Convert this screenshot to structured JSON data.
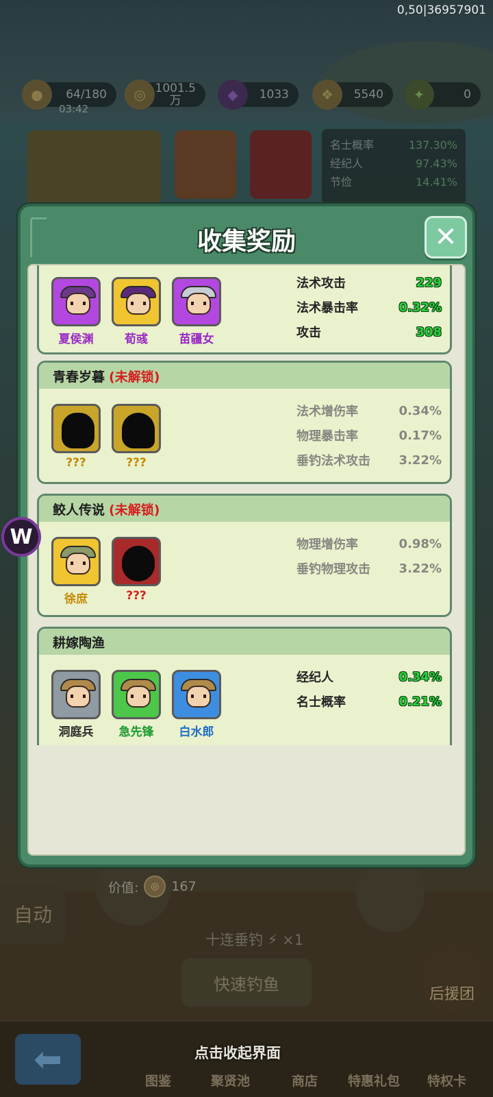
{
  "top_id": "0,50|36957901",
  "resources": [
    {
      "icon": "food-icon",
      "value": "64/180",
      "sub": "03:42"
    },
    {
      "icon": "coin-icon",
      "value": "1001.5\n万"
    },
    {
      "icon": "gem-icon",
      "value": "1033"
    },
    {
      "icon": "fish-icon",
      "value": "5540"
    },
    {
      "icon": "energy-icon",
      "value": "0"
    }
  ],
  "bg_stats": [
    {
      "label": "名士概率",
      "value": "137.30%"
    },
    {
      "label": "经纪人",
      "value": "97.43%"
    },
    {
      "label": "节俭",
      "value": "14.41%"
    }
  ],
  "dialog": {
    "title": "收集奖励",
    "close_label": "✕"
  },
  "cards": [
    {
      "title": "",
      "locked": false,
      "heroes": [
        {
          "name": "夏侯渊",
          "rarity": "purple",
          "name_color": "#9b2bc4"
        },
        {
          "name": "荀彧",
          "rarity": "gold",
          "name_color": "#9b2bc4"
        },
        {
          "name": "苗疆女",
          "rarity": "purple",
          "name_color": "#9b2bc4"
        }
      ],
      "bonuses": [
        {
          "label": "法术攻击",
          "value": "229"
        },
        {
          "label": "法术暴击率",
          "value": "0.32%"
        },
        {
          "label": "攻击",
          "value": "308"
        }
      ]
    },
    {
      "title": "青春岁暮",
      "locked": true,
      "locked_label": "(未解锁)",
      "heroes": [
        {
          "name": "???",
          "rarity": "gold-locked",
          "name_color": "#c48a00"
        },
        {
          "name": "???",
          "rarity": "gold-locked",
          "name_color": "#c48a00"
        }
      ],
      "bonuses": [
        {
          "label": "法术增伤率",
          "value": "0.34%"
        },
        {
          "label": "物理暴击率",
          "value": "0.17%"
        },
        {
          "label": "垂钓法术攻击",
          "value": "3.22%"
        }
      ]
    },
    {
      "title": "鲛人传说",
      "locked": true,
      "locked_label": "(未解锁)",
      "heroes": [
        {
          "name": "徐庶",
          "rarity": "gold",
          "name_color": "#c48a00"
        },
        {
          "name": "???",
          "rarity": "red-locked",
          "name_color": "#d51f1f"
        }
      ],
      "bonuses": [
        {
          "label": "物理增伤率",
          "value": "0.98%"
        },
        {
          "label": "垂钓物理攻击",
          "value": "3.22%"
        }
      ]
    },
    {
      "title": "耕嫁陶渔",
      "locked": false,
      "heroes": [
        {
          "name": "洞庭兵",
          "rarity": "gray",
          "name_color": "#2a2a2a"
        },
        {
          "name": "急先锋",
          "rarity": "green",
          "name_color": "#1d9a2e"
        },
        {
          "name": "白水郎",
          "rarity": "blue",
          "name_color": "#1e6fc4"
        }
      ],
      "bonuses": [
        {
          "label": "经纪人",
          "value": "0.34%"
        },
        {
          "label": "名士概率",
          "value": "0.21%"
        }
      ]
    }
  ],
  "background": {
    "auto_label": "自动",
    "value_label": "价值:",
    "value": "167",
    "ten_fish_label": "十连垂钓",
    "ten_fish_count": "×1",
    "fast_fish_label": "快速钓鱼",
    "support_label": "后援团",
    "collapse_hint": "点击收起界面",
    "nav": [
      "图鉴",
      "聚贤池",
      "商店",
      "特惠礼包",
      "特权卡"
    ]
  },
  "floating_badge": "W"
}
